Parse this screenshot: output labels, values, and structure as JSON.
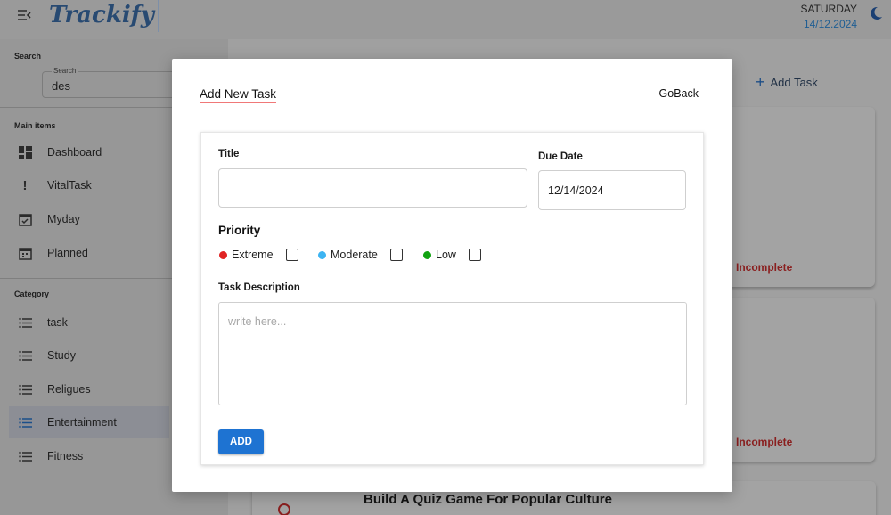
{
  "app": {
    "logo_text": "Trackify"
  },
  "header": {
    "day": "SATURDAY",
    "date": "14/12.2024"
  },
  "sidebar": {
    "search_label": "Search",
    "search_legend": "Search",
    "search_value": "des",
    "main_items_label": "Main items",
    "main_items": [
      {
        "label": "Dashboard",
        "icon": "dashboard-icon"
      },
      {
        "label": "VitalTask",
        "icon": "exclamation-icon"
      },
      {
        "label": "Myday",
        "icon": "calendar-check-icon"
      },
      {
        "label": "Planned",
        "icon": "calendar-icon"
      }
    ],
    "category_label": "Category",
    "categories": [
      {
        "label": "task",
        "icon": "list-icon"
      },
      {
        "label": "Study",
        "icon": "list-icon"
      },
      {
        "label": "Religues",
        "icon": "list-icon"
      },
      {
        "label": "Entertainment",
        "icon": "list-icon",
        "active": true
      },
      {
        "label": "Fitness",
        "icon": "list-icon"
      }
    ]
  },
  "background": {
    "add_task_label": "Add Task",
    "status_1": "Incomplete",
    "status_2": "Incomplete",
    "task_title": "Build A Quiz Game For Popular Culture"
  },
  "modal": {
    "title": "Add New Task",
    "goback_label": "GoBack",
    "form": {
      "title_label": "Title",
      "title_value": "",
      "due_date_label": "Due Date",
      "due_date_value": "12/14/2024",
      "priority_label": "Priority",
      "priorities": [
        {
          "label": "Extreme",
          "color": "#e02424",
          "checked": false
        },
        {
          "label": "Moderate",
          "color": "#3db4f2",
          "checked": false
        },
        {
          "label": "Low",
          "color": "#12a312",
          "checked": false
        }
      ],
      "description_label": "Task Description",
      "description_placeholder": "write here...",
      "add_button_label": "ADD"
    }
  },
  "colors": {
    "accent": "#1e73d2",
    "incomplete": "#8a1f1f",
    "overlay_bg": "#9a9a9a"
  }
}
